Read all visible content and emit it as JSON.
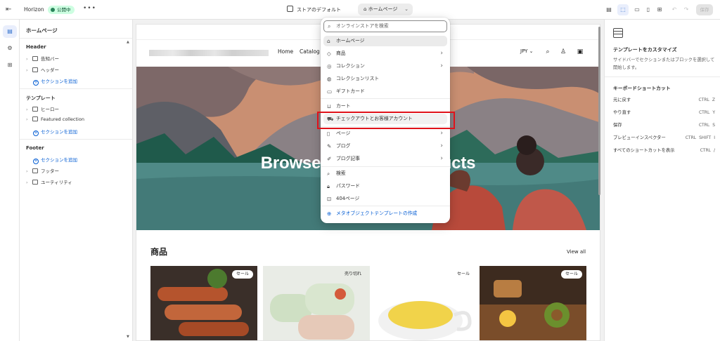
{
  "topbar": {
    "exit_icon": "exit-icon",
    "app_name": "Horizon",
    "status_badge": "公開中",
    "more": "•••",
    "theme_label": "ストアのデフォルト",
    "page_selector": "ホームページ",
    "save_label": "保存"
  },
  "sidebar": {
    "title": "ホームページ",
    "header_group": "Header",
    "header_items": [
      "告知バー",
      "ヘッダー"
    ],
    "add_section": "セクションを追加",
    "template_group": "テンプレート",
    "template_items": [
      "ヒーロー",
      "Featured collection"
    ],
    "footer_group": "Footer",
    "footer_items": [
      "フッター",
      "ユーティリティ"
    ]
  },
  "preview": {
    "nav": [
      "Home",
      "Catalog"
    ],
    "currency": "JPY",
    "hero_title": "Browse our latest products",
    "section_title": "商品",
    "view_all": "View all",
    "products": [
      {
        "badge": "セール"
      },
      {
        "badge": "売り切れ"
      },
      {
        "badge": "セール"
      },
      {
        "badge": "セール"
      }
    ]
  },
  "dropdown": {
    "search_placeholder": "オンラインストアを検索",
    "items": [
      {
        "label": "ホームページ",
        "icon": "home-icon",
        "selected": true,
        "arrow": false
      },
      {
        "label": "商品",
        "icon": "tag-icon",
        "arrow": true
      },
      {
        "label": "コレクション",
        "icon": "collection-icon",
        "arrow": true
      },
      {
        "label": "コレクションリスト",
        "icon": "collection-list-icon",
        "arrow": false
      },
      {
        "label": "ギフトカード",
        "icon": "gift-card-icon",
        "arrow": false
      },
      {
        "label": "カート",
        "icon": "cart-icon",
        "arrow": false
      },
      {
        "label": "チェックアウトとお客様アカウント",
        "icon": "checkout-icon",
        "arrow": false,
        "highlighted": true
      },
      {
        "label": "ページ",
        "icon": "page-icon",
        "arrow": true
      },
      {
        "label": "ブログ",
        "icon": "blog-icon",
        "arrow": true
      },
      {
        "label": "ブログ記事",
        "icon": "blog-post-icon",
        "arrow": true
      },
      {
        "label": "検索",
        "icon": "search-icon",
        "arrow": false
      },
      {
        "label": "パスワード",
        "icon": "lock-icon",
        "arrow": false
      },
      {
        "label": "404ページ",
        "icon": "not-found-icon",
        "arrow": false
      }
    ],
    "create_metaobject": "メタオブジェクトテンプレートの作成"
  },
  "right_panel": {
    "title": "テンプレートをカスタマイズ",
    "description": "サイドバーでセクションまたはブロックを選択して開始します。",
    "shortcuts_title": "キーボードショートカット",
    "shortcuts": [
      {
        "label": "元に戻す",
        "keys": [
          "CTRL",
          "Z"
        ]
      },
      {
        "label": "やり直す",
        "keys": [
          "CTRL",
          "Y"
        ]
      },
      {
        "label": "保存",
        "keys": [
          "CTRL",
          "S"
        ]
      },
      {
        "label": "プレビューインスペクター",
        "keys": [
          "CTRL",
          "SHIFT",
          "I"
        ]
      },
      {
        "label": "すべてのショートカットを表示",
        "keys": [
          "CTRL",
          "/"
        ]
      }
    ]
  },
  "colors": {
    "accent_blue": "#005bd3",
    "status_green": "#29845a",
    "highlight_red": "#e0121a"
  }
}
